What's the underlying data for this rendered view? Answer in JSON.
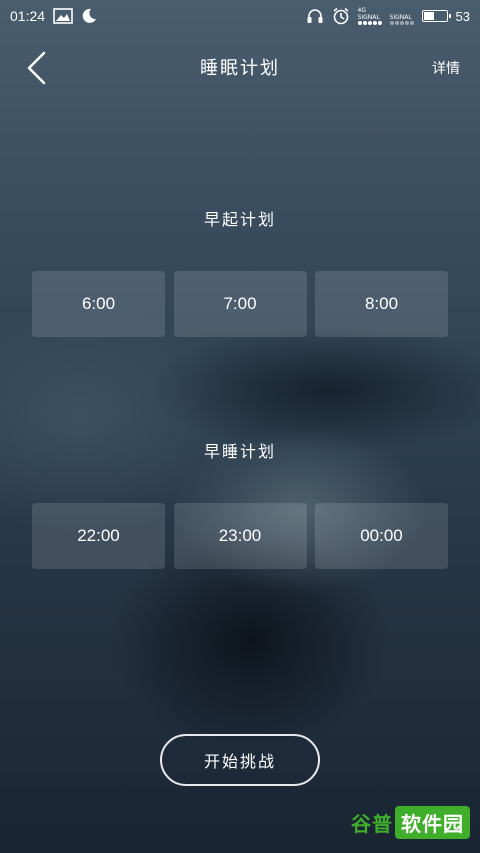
{
  "status_bar": {
    "time": "01:24",
    "network_label": "4G",
    "signal1_label": "SIGNAL",
    "signal2_label": "SIGNAL",
    "battery_percent": "53",
    "battery_level": 0.53,
    "icons": [
      "image-notification-icon",
      "moon-icon",
      "headset-icon",
      "alarm-icon",
      "battery-icon"
    ]
  },
  "header": {
    "title": "睡眠计划",
    "detail_label": "详情",
    "back_icon": "chevron-left-icon"
  },
  "wake_plan": {
    "title": "早起计划",
    "options": [
      "6:00",
      "7:00",
      "8:00"
    ]
  },
  "sleep_plan": {
    "title": "早睡计划",
    "options": [
      "22:00",
      "23:00",
      "00:00"
    ]
  },
  "start_button": {
    "label": "开始挑战"
  },
  "watermark": {
    "part1": "谷普",
    "part2": "软件园"
  }
}
